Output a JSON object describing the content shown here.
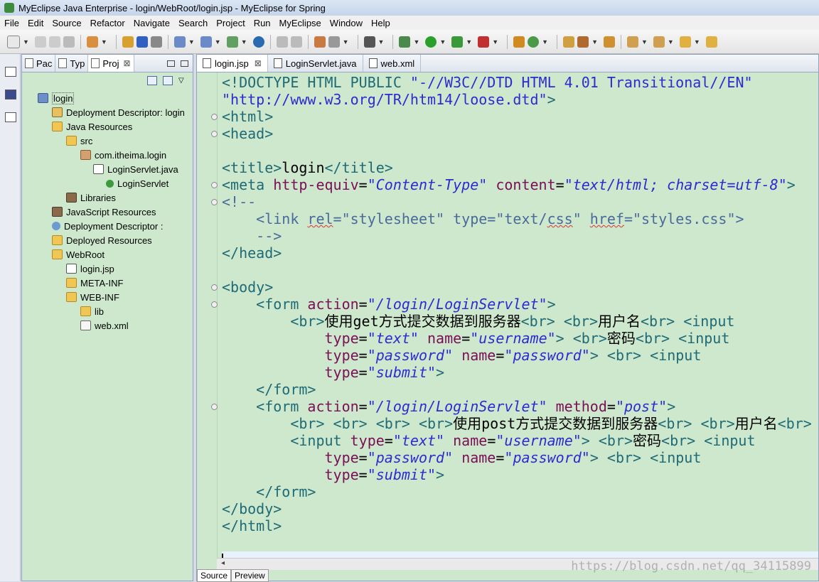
{
  "window": {
    "title": "MyEclipse Java Enterprise - login/WebRoot/login.jsp - MyEclipse for Spring"
  },
  "menu": [
    "File",
    "Edit",
    "Source",
    "Refactor",
    "Navigate",
    "Search",
    "Project",
    "Run",
    "MyEclipse",
    "Window",
    "Help"
  ],
  "explorer": {
    "tabs": [
      {
        "label": "Pac"
      },
      {
        "label": "Typ"
      },
      {
        "label": "Proj",
        "close": "⊠"
      }
    ],
    "tree": [
      {
        "label": "login",
        "icon": "project-icon"
      },
      {
        "label": "Deployment Descriptor: login",
        "icon": "descriptor-icon"
      },
      {
        "label": "Java Resources",
        "icon": "folder-icon"
      },
      {
        "label": "src",
        "icon": "folder-icon"
      },
      {
        "label": "com.itheima.login",
        "icon": "package-icon"
      },
      {
        "label": "LoginServlet.java",
        "icon": "java-file-icon"
      },
      {
        "label": "LoginServlet",
        "icon": "class-icon"
      },
      {
        "label": "Libraries",
        "icon": "library-icon"
      },
      {
        "label": "JavaScript Resources",
        "icon": "library-icon"
      },
      {
        "label": "Deployment Descriptor :",
        "icon": "globe-icon"
      },
      {
        "label": "Deployed Resources",
        "icon": "folder-icon"
      },
      {
        "label": "WebRoot",
        "icon": "folder-icon"
      },
      {
        "label": "login.jsp",
        "icon": "jsp-file-icon"
      },
      {
        "label": "META-INF",
        "icon": "folder-icon"
      },
      {
        "label": "WEB-INF",
        "icon": "folder-icon"
      },
      {
        "label": "lib",
        "icon": "folder-icon"
      },
      {
        "label": "web.xml",
        "icon": "xml-file-icon"
      }
    ]
  },
  "editor": {
    "tabs": [
      {
        "label": "login.jsp",
        "close": "⊠"
      },
      {
        "label": "LoginServlet.java"
      },
      {
        "label": "web.xml"
      }
    ],
    "bottom_tabs": [
      "Source",
      "Preview"
    ],
    "watermark": "https://blog.csdn.net/qq_34115899",
    "code_lines": [
      [
        [
          "tag",
          "<!DOCTYPE HTML PUBLIC "
        ],
        [
          "str",
          "\"-//W3C//DTD HTML 4.01 Transitional//EN\""
        ]
      ],
      [
        [
          "str",
          "\"http://www.w3.org/TR/htm14/loose.dtd\""
        ],
        [
          "tag",
          ">"
        ]
      ],
      [
        [
          "tag",
          "<html>"
        ]
      ],
      [
        [
          "tag",
          "<head>"
        ]
      ],
      [],
      [
        [
          "tag",
          "<title>"
        ],
        [
          "txt",
          "login"
        ],
        [
          "tag",
          "</title>"
        ]
      ],
      [
        [
          "tag",
          "<meta "
        ],
        [
          "attr",
          "http-equiv"
        ],
        [
          "txt",
          "="
        ],
        [
          "stri",
          "\"Content-Type\""
        ],
        [
          "txt",
          " "
        ],
        [
          "attr",
          "content"
        ],
        [
          "txt",
          "="
        ],
        [
          "stri",
          "\"text/html; charset=utf-8\""
        ],
        [
          "tag",
          ">"
        ]
      ],
      [
        [
          "cmt",
          "<!--"
        ]
      ],
      [
        [
          "cmt",
          "    <link "
        ],
        [
          "cmt",
          "rel"
        ],
        [
          "cmt",
          "=\"stylesheet\" type=\"text/"
        ],
        [
          "cmt",
          "css"
        ],
        [
          "cmt",
          "\" "
        ],
        [
          "cmt",
          "href"
        ],
        [
          "cmt",
          "=\"styles.css\">"
        ]
      ],
      [
        [
          "cmt",
          "    -->"
        ]
      ],
      [
        [
          "tag",
          "</head>"
        ]
      ],
      [],
      [
        [
          "tag",
          "<body>"
        ]
      ],
      [
        [
          "tag",
          "    <form "
        ],
        [
          "attr",
          "action"
        ],
        [
          "txt",
          "="
        ],
        [
          "stri",
          "\"/login/LoginServlet\""
        ],
        [
          "tag",
          ">"
        ]
      ],
      [
        [
          "tag",
          "        <br>"
        ],
        [
          "txt",
          "使用get方式提交数据到服务器"
        ],
        [
          "tag",
          "<br> <br>"
        ],
        [
          "txt",
          "用户名"
        ],
        [
          "tag",
          "<br> <input"
        ]
      ],
      [
        [
          "txt",
          "            "
        ],
        [
          "attr",
          "type"
        ],
        [
          "txt",
          "="
        ],
        [
          "stri",
          "\"text\""
        ],
        [
          "txt",
          " "
        ],
        [
          "attr",
          "name"
        ],
        [
          "txt",
          "="
        ],
        [
          "stri",
          "\"username\""
        ],
        [
          "tag",
          "> <br>"
        ],
        [
          "txt",
          "密码"
        ],
        [
          "tag",
          "<br> <input"
        ]
      ],
      [
        [
          "txt",
          "            "
        ],
        [
          "attr",
          "type"
        ],
        [
          "txt",
          "="
        ],
        [
          "stri",
          "\"password\""
        ],
        [
          "txt",
          " "
        ],
        [
          "attr",
          "name"
        ],
        [
          "txt",
          "="
        ],
        [
          "stri",
          "\"password\""
        ],
        [
          "tag",
          "> <br> <input"
        ]
      ],
      [
        [
          "txt",
          "            "
        ],
        [
          "attr",
          "type"
        ],
        [
          "txt",
          "="
        ],
        [
          "stri",
          "\"submit\""
        ],
        [
          "tag",
          ">"
        ]
      ],
      [
        [
          "tag",
          "    </form>"
        ]
      ],
      [
        [
          "tag",
          "    <form "
        ],
        [
          "attr",
          "action"
        ],
        [
          "txt",
          "="
        ],
        [
          "stri",
          "\"/login/LoginServlet\""
        ],
        [
          "txt",
          " "
        ],
        [
          "attr",
          "method"
        ],
        [
          "txt",
          "="
        ],
        [
          "stri",
          "\"post\""
        ],
        [
          "tag",
          ">"
        ]
      ],
      [
        [
          "tag",
          "        <br> <br> <br> <br>"
        ],
        [
          "txt",
          "使用post方式提交数据到服务器"
        ],
        [
          "tag",
          "<br> <br>"
        ],
        [
          "txt",
          "用户名"
        ],
        [
          "tag",
          "<br>"
        ]
      ],
      [
        [
          "tag",
          "        <input "
        ],
        [
          "attr",
          "type"
        ],
        [
          "txt",
          "="
        ],
        [
          "stri",
          "\"text\""
        ],
        [
          "txt",
          " "
        ],
        [
          "attr",
          "name"
        ],
        [
          "txt",
          "="
        ],
        [
          "stri",
          "\"username\""
        ],
        [
          "tag",
          "> <br>"
        ],
        [
          "txt",
          "密码"
        ],
        [
          "tag",
          "<br> <input"
        ]
      ],
      [
        [
          "txt",
          "            "
        ],
        [
          "attr",
          "type"
        ],
        [
          "txt",
          "="
        ],
        [
          "stri",
          "\"password\""
        ],
        [
          "txt",
          " "
        ],
        [
          "attr",
          "name"
        ],
        [
          "txt",
          "="
        ],
        [
          "stri",
          "\"password\""
        ],
        [
          "tag",
          "> <br> <input"
        ]
      ],
      [
        [
          "txt",
          "            "
        ],
        [
          "attr",
          "type"
        ],
        [
          "txt",
          "="
        ],
        [
          "stri",
          "\"submit\""
        ],
        [
          "tag",
          ">"
        ]
      ],
      [
        [
          "tag",
          "    </form>"
        ]
      ],
      [
        [
          "tag",
          "</body>"
        ]
      ],
      [
        [
          "tag",
          "</html>"
        ]
      ],
      []
    ],
    "fold_lines": [
      2,
      3,
      6,
      7,
      12,
      13,
      19
    ]
  },
  "colors": {
    "editor_bg": "#cde8cd",
    "tag": "#1f6a75",
    "attr": "#7a0f55",
    "string": "#2b2bd0",
    "current_line": "#e8f2ff"
  }
}
